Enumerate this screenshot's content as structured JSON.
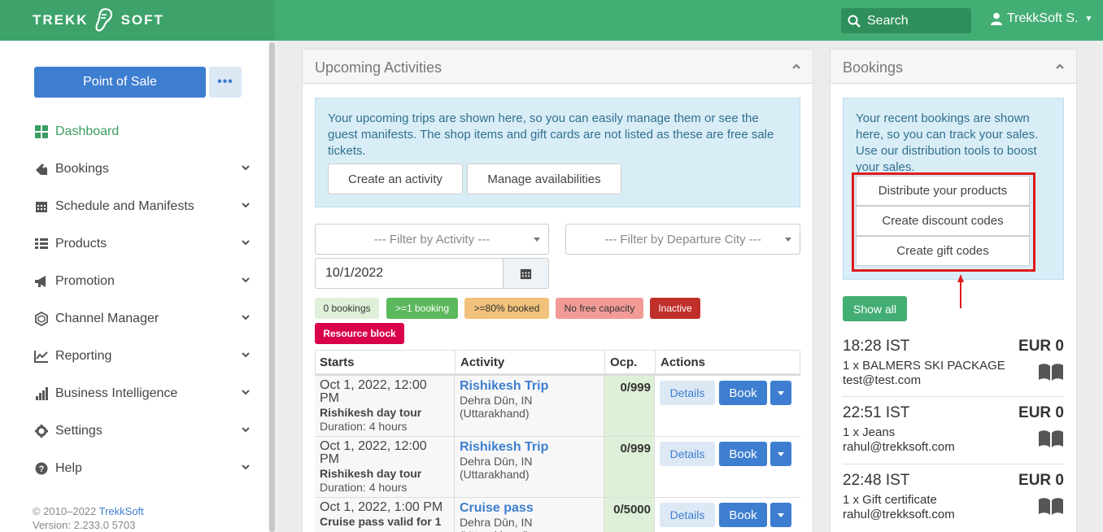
{
  "header": {
    "brand_left": "TREKK",
    "brand_right": "SOFT",
    "search_label": "Search",
    "user_name": "TrekkSoft S."
  },
  "sidebar": {
    "pos_button": "Point of Sale",
    "more_button": "•••",
    "items": [
      {
        "label": "Dashboard",
        "icon": "dashboard-icon"
      },
      {
        "label": "Bookings",
        "icon": "tag-icon"
      },
      {
        "label": "Schedule and Manifests",
        "icon": "calendar-icon"
      },
      {
        "label": "Products",
        "icon": "list-icon"
      },
      {
        "label": "Promotion",
        "icon": "megaphone-icon"
      },
      {
        "label": "Channel Manager",
        "icon": "network-icon"
      },
      {
        "label": "Reporting",
        "icon": "line-chart-icon"
      },
      {
        "label": "Business Intelligence",
        "icon": "bar-chart-icon"
      },
      {
        "label": "Settings",
        "icon": "gear-icon"
      },
      {
        "label": "Help",
        "icon": "help-icon"
      }
    ],
    "footer_copyright": "© 2010–2022 ",
    "footer_link": "TrekkSoft",
    "footer_version": "Version: 2.233.0 5703"
  },
  "upcoming": {
    "title": "Upcoming Activities",
    "info_text": "Your upcoming trips are shown here, so you can easily manage them or see the guest manifests. The shop items and gift cards are not listed as these are free sale tickets.",
    "create_activity": "Create an activity",
    "manage_availabilities": "Manage availabilities",
    "filter_activity": "--- Filter by Activity ---",
    "filter_city": "--- Filter by Departure City ---",
    "date_value": "10/1/2022",
    "legend": [
      {
        "label": "0 bookings",
        "bg": "#dff0d8",
        "fg": "#333"
      },
      {
        "label": ">=1 booking",
        "bg": "#5cb85c",
        "fg": "#fff"
      },
      {
        "label": ">=80% booked",
        "bg": "#f0c27b",
        "fg": "#333"
      },
      {
        "label": "No free capacity",
        "bg": "#f29b96",
        "fg": "#333"
      },
      {
        "label": "Inactive",
        "bg": "#c0302b",
        "fg": "#fff"
      },
      {
        "label": "Resource block",
        "bg": "#d9004c",
        "fg": "#fff"
      }
    ],
    "columns": [
      "Starts",
      "Activity",
      "Ocp.",
      "Actions"
    ],
    "rows": [
      {
        "date": "Oct 1, 2022, 12:00 PM",
        "tour": "Rishikesh day tour",
        "duration": "Duration: 4 hours",
        "activity": "Rishikesh Trip",
        "location": "Dehra Dūn, IN (Uttarakhand)",
        "ocp": "0/999",
        "details": "Details",
        "book": "Book"
      },
      {
        "date": "Oct 1, 2022, 12:00 PM",
        "tour": "Rishikesh day tour",
        "duration": "Duration: 4 hours",
        "activity": "Rishikesh Trip",
        "location": "Dehra Dūn, IN (Uttarakhand)",
        "ocp": "0/999",
        "details": "Details",
        "book": "Book"
      },
      {
        "date": "Oct 1, 2022, 1:00 PM",
        "tour": "Cruise pass valid for 1",
        "duration": "",
        "activity": "Cruise pass",
        "location": "Dehra Dūn, IN (Uttarakhand)",
        "ocp": "0/5000",
        "details": "Details",
        "book": "Book"
      }
    ]
  },
  "bookings": {
    "title": "Bookings",
    "info_text": "Your recent bookings are shown here, so you can track your sales. Use our distribution tools to boost your sales.",
    "distribute": "Distribute your products",
    "discount": "Create discount codes",
    "gift": "Create gift codes",
    "show_all": "Show all",
    "entries": [
      {
        "time": "18:28 IST",
        "amount": "EUR 0",
        "item": "1 x BALMERS SKI PACKAGE",
        "email": "test@test.com"
      },
      {
        "time": "22:51 IST",
        "amount": "EUR 0",
        "item": "1 x Jeans",
        "email": "rahul@trekksoft.com"
      },
      {
        "time": "22:48 IST",
        "amount": "EUR 0",
        "item": "1 x Gift certificate",
        "email": "rahul@trekksoft.com"
      }
    ]
  },
  "colors": {
    "brand_green": "#43ae74",
    "primary_blue": "#3e7ed0",
    "highlight_red": "#e01b1b"
  }
}
